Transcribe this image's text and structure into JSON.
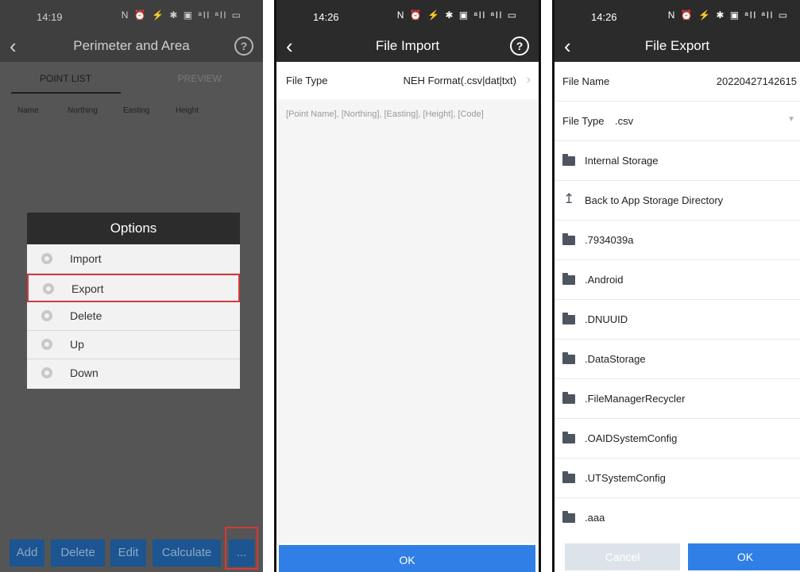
{
  "panel1": {
    "time": "14:19",
    "status_icons": "N ⏰ ⚡ ✱ ▣ ᵃll ᵃll ▭",
    "title": "Perimeter and Area",
    "tab_point_list": "POINT LIST",
    "tab_preview": "PREVIEW",
    "columns": [
      "Name",
      "Northing",
      "Easting",
      "Height"
    ],
    "dialog_title": "Options",
    "options": [
      "Import",
      "Export",
      "Delete",
      "Up",
      "Down"
    ],
    "buttons": [
      "Add",
      "Delete",
      "Edit",
      "Calculate",
      "..."
    ]
  },
  "panel2": {
    "time": "14:26",
    "status_icons": "N ⏰ ⚡ ✱ ▣ ᵃll ᵃll ▭",
    "title": "File Import",
    "file_type_label": "File Type",
    "file_type_value": "NEH Format(.csv|dat|txt)",
    "hint": "[Point Name], [Northing], [Easting], [Height], [Code]",
    "ok": "OK"
  },
  "panel3": {
    "time": "14:26",
    "status_icons": "N ⏰ ⚡ ✱ ▣ ᵃll ᵃll ▭",
    "title": "File Export",
    "file_name_label": "File Name",
    "file_name_value": "20220427142615",
    "file_type_label": "File Type",
    "file_type_value": ".csv",
    "internal_storage": "Internal Storage",
    "back_to_app": "Back to App Storage Directory",
    "folders": [
      ".7934039a",
      ".Android",
      ".DNUUID",
      ".DataStorage",
      ".FileManagerRecycler",
      ".OAIDSystemConfig",
      ".UTSystemConfig",
      ".aaa"
    ],
    "cancel": "Cancel",
    "ok": "OK"
  },
  "colors": {
    "accent_blue": "#2f7fe6",
    "highlight_red": "#d33a3a",
    "dark_bar": "#2b2b2b"
  }
}
